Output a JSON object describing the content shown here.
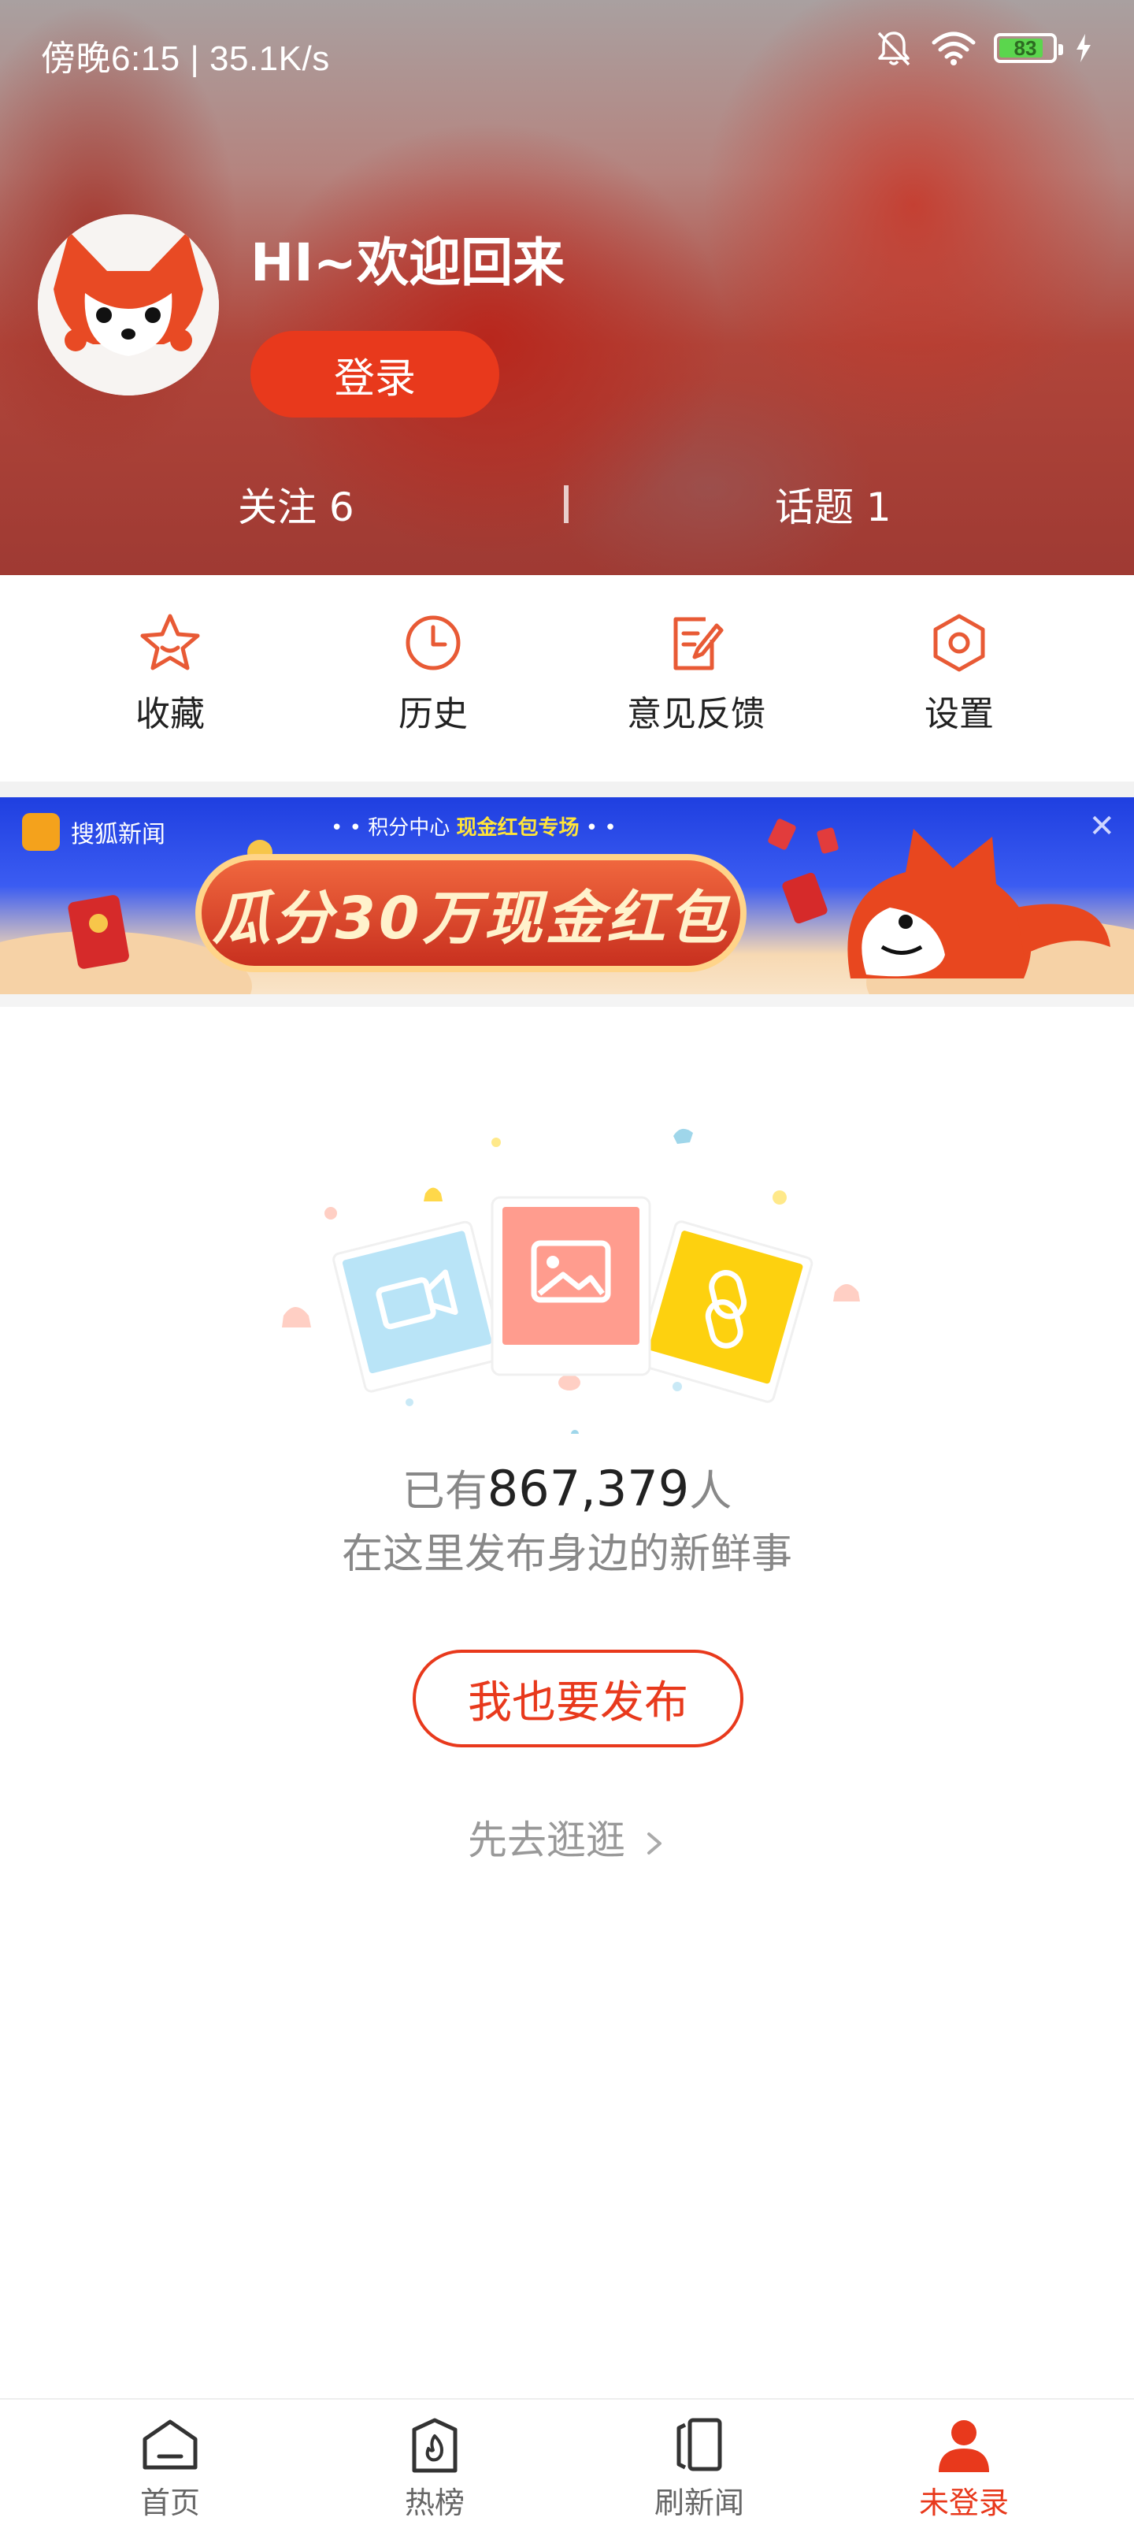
{
  "status_bar": {
    "time_speed": "傍晚6:15 | 35.1K/s",
    "battery": "83",
    "battery_level": 0.83
  },
  "profile": {
    "greeting": "HI~欢迎回来",
    "login_label": "登录",
    "follow": "关注 6",
    "topic": "话题 1"
  },
  "quick_actions": [
    {
      "label": "收藏",
      "icon": "star-icon"
    },
    {
      "label": "历史",
      "icon": "clock-icon"
    },
    {
      "label": "意见反馈",
      "icon": "feedback-icon"
    },
    {
      "label": "设置",
      "icon": "settings-icon"
    }
  ],
  "banner": {
    "brand": "搜狐新闻",
    "topline_prefix": "积分中心",
    "topline_highlight": "现金红包专场",
    "title": "瓜分30万现金红包"
  },
  "empty_state": {
    "prefix": "已有",
    "count": "867,379",
    "suffix": "人",
    "subtitle": "在这里发布身边的新鲜事",
    "publish_label": "我也要发布",
    "browse_label": "先去逛逛"
  },
  "bottom_nav": [
    {
      "label": "首页",
      "icon": "home-icon"
    },
    {
      "label": "热榜",
      "icon": "hot-list-icon"
    },
    {
      "label": "刷新闻",
      "icon": "cards-icon"
    },
    {
      "label": "未登录",
      "icon": "user-icon",
      "active": true
    }
  ],
  "colors": {
    "accent": "#e8391c",
    "icon_accent": "#e85a35"
  }
}
